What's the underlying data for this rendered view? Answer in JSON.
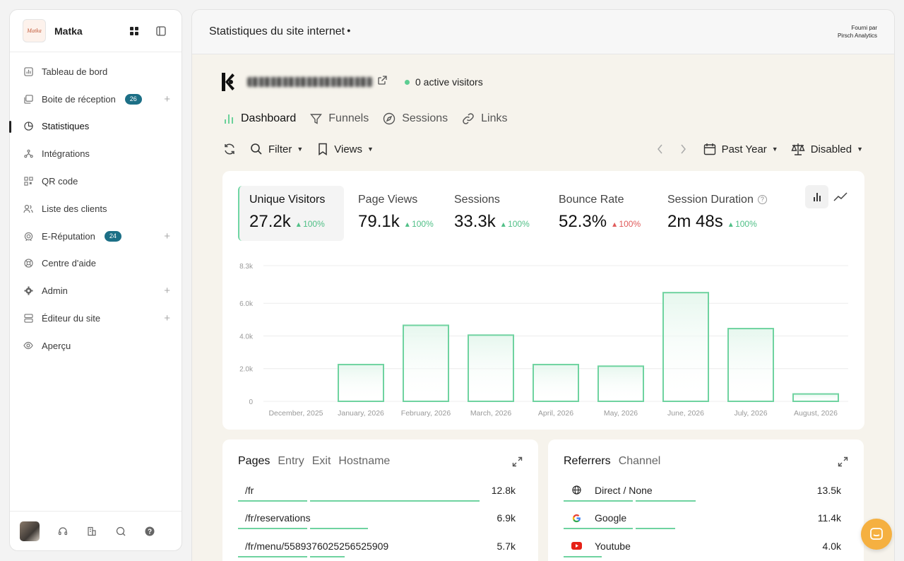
{
  "sidebar": {
    "logo_text": "Matka",
    "brand": "Matka",
    "items": [
      {
        "label": "Tableau de bord"
      },
      {
        "label": "Boite de réception",
        "badge": "26"
      },
      {
        "label": "Statistiques"
      },
      {
        "label": "Intégrations"
      },
      {
        "label": "QR code"
      },
      {
        "label": "Liste des clients"
      },
      {
        "label": "E-Réputation",
        "badge": "24"
      },
      {
        "label": "Centre d'aide"
      },
      {
        "label": "Admin"
      },
      {
        "label": "Éditeur du site"
      },
      {
        "label": "Aperçu"
      }
    ]
  },
  "header": {
    "title": "Statistiques du site internet",
    "powered_line1": "Fourni par",
    "powered_line2": "Pirsch Analytics"
  },
  "site": {
    "active_visitors": "0 active visitors"
  },
  "tabs": [
    {
      "label": "Dashboard"
    },
    {
      "label": "Funnels"
    },
    {
      "label": "Sessions"
    },
    {
      "label": "Links"
    }
  ],
  "toolbar": {
    "filter": "Filter",
    "views": "Views",
    "period": "Past Year",
    "compare": "Disabled"
  },
  "metrics": [
    {
      "label": "Unique Visitors",
      "value": "27.2k",
      "delta": "100%"
    },
    {
      "label": "Page Views",
      "value": "79.1k",
      "delta": "100%"
    },
    {
      "label": "Sessions",
      "value": "33.3k",
      "delta": "100%"
    },
    {
      "label": "Bounce Rate",
      "value": "52.3%",
      "delta": "100%"
    },
    {
      "label": "Session Duration",
      "value": "2m 48s",
      "delta": "100%"
    }
  ],
  "chart_data": {
    "type": "bar",
    "series": [
      {
        "values": [
          0,
          2250,
          4650,
          4050,
          2250,
          2150,
          6650,
          4450,
          450
        ]
      }
    ],
    "categories": [
      "December, 2025",
      "January, 2026",
      "February, 2026",
      "March, 2026",
      "April, 2026",
      "May, 2026",
      "June, 2026",
      "July, 2026",
      "August, 2026"
    ],
    "yticks": [
      0,
      2000,
      4000,
      6000,
      8300
    ],
    "yticklabels": [
      "0",
      "2.0k",
      "4.0k",
      "6.0k",
      "8.3k"
    ],
    "ylim": [
      0,
      8300
    ],
    "grid": true,
    "colors": {
      "bar_stroke": "#6fd3a0",
      "bar_fill_top": "#e6f7ee",
      "grid": "#ececec",
      "tick": "#999999"
    }
  },
  "pages": {
    "tabs": [
      "Pages",
      "Entry",
      "Exit",
      "Hostname"
    ],
    "rows": [
      {
        "label": "/fr",
        "value": "12.8k",
        "share": 0.95
      },
      {
        "label": "/fr/reservations",
        "value": "6.9k",
        "share": 0.51
      },
      {
        "label": "/fr/menu/5589376025256525909",
        "value": "5.7k",
        "share": 0.42
      }
    ]
  },
  "referrers": {
    "tabs": [
      "Referrers",
      "Channel"
    ],
    "rows": [
      {
        "label": "Direct / None",
        "value": "13.5k",
        "icon": "globe-icon",
        "share": 0.52
      },
      {
        "label": "Google",
        "value": "11.4k",
        "icon": "google-icon",
        "share": 0.44
      },
      {
        "label": "Youtube",
        "value": "4.0k",
        "icon": "youtube-icon",
        "share": 0.15
      }
    ]
  }
}
